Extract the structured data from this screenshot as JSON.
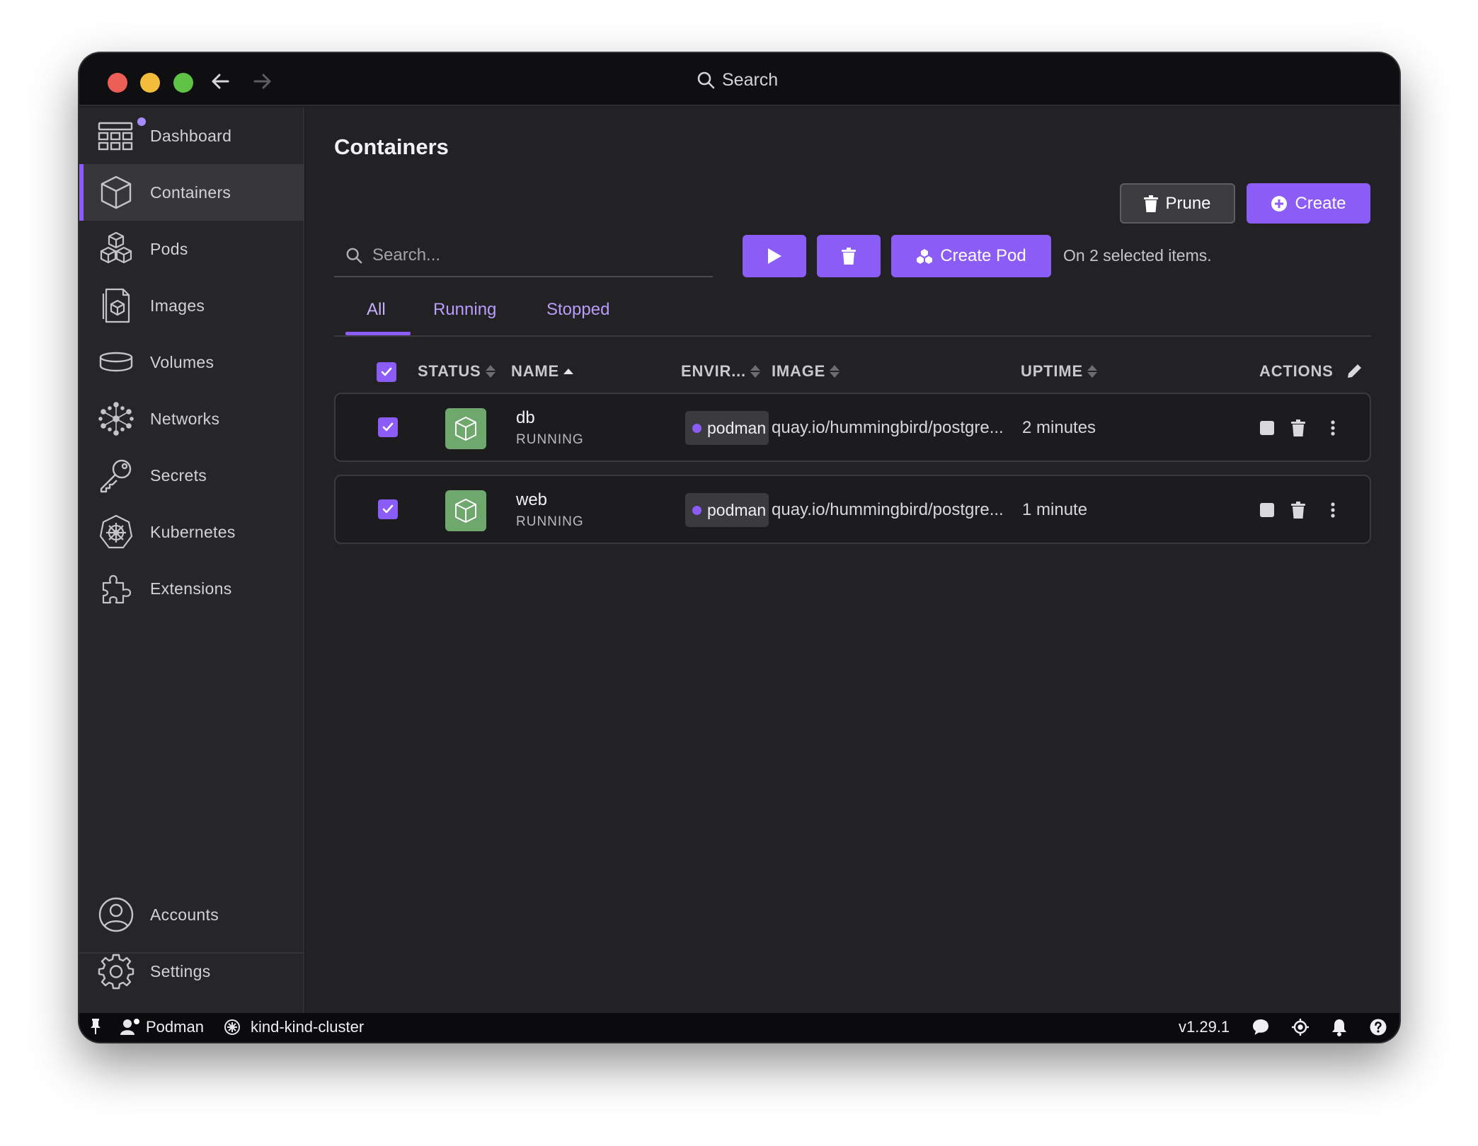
{
  "titlebar": {
    "search_label": "Search"
  },
  "sidebar": {
    "items": [
      {
        "label": "Dashboard",
        "icon": "dashboard-icon"
      },
      {
        "label": "Containers",
        "icon": "container-icon"
      },
      {
        "label": "Pods",
        "icon": "pods-icon"
      },
      {
        "label": "Images",
        "icon": "images-icon"
      },
      {
        "label": "Volumes",
        "icon": "volumes-icon"
      },
      {
        "label": "Networks",
        "icon": "networks-icon"
      },
      {
        "label": "Secrets",
        "icon": "key-icon"
      },
      {
        "label": "Kubernetes",
        "icon": "kubernetes-icon"
      },
      {
        "label": "Extensions",
        "icon": "puzzle-icon"
      }
    ],
    "bottom": [
      {
        "label": "Accounts",
        "icon": "account-icon"
      },
      {
        "label": "Settings",
        "icon": "gear-icon"
      }
    ]
  },
  "main": {
    "title": "Containers",
    "prune_label": "Prune",
    "create_label": "Create",
    "search_placeholder": "Search...",
    "create_pod_label": "Create Pod",
    "selection_text": "On 2 selected items.",
    "tabs": [
      "All",
      "Running",
      "Stopped"
    ],
    "columns": {
      "status": "STATUS",
      "name": "NAME",
      "environment": "ENVIR...",
      "image": "IMAGE",
      "uptime": "UPTIME",
      "actions": "ACTIONS"
    },
    "rows": [
      {
        "name": "db",
        "state": "RUNNING",
        "environment": "podman",
        "image": "quay.io/hummingbird/postgre...",
        "uptime": "2 minutes",
        "checked": true
      },
      {
        "name": "web",
        "state": "RUNNING",
        "environment": "podman",
        "image": "quay.io/hummingbird/postgre...",
        "uptime": "1 minute",
        "checked": true
      }
    ]
  },
  "statusbar": {
    "engine": "Podman",
    "cluster": "kind-kind-cluster",
    "version": "v1.29.1"
  },
  "colors": {
    "accent": "#8b5cf6",
    "container_running": "#6fa86c"
  }
}
